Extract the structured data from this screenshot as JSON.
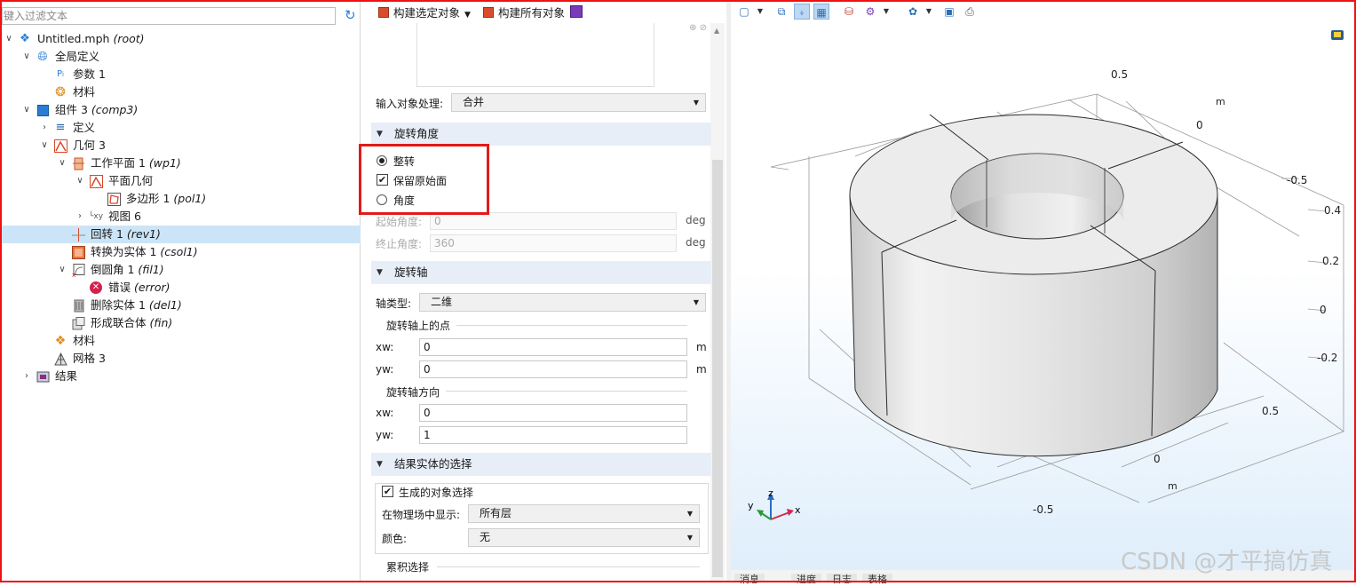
{
  "tree": {
    "filter_placeholder": "键入过滤文本",
    "items": [
      {
        "label": "Untitled.mph",
        "tag": "(root)"
      },
      {
        "label": "全局定义",
        "tag": ""
      },
      {
        "label": "参数 1",
        "tag": ""
      },
      {
        "label": "材料",
        "tag": ""
      },
      {
        "label": "组件 3",
        "tag": "(comp3)"
      },
      {
        "label": "定义",
        "tag": ""
      },
      {
        "label": "几何 3",
        "tag": ""
      },
      {
        "label": "工作平面 1",
        "tag": "(wp1)"
      },
      {
        "label": "平面几何",
        "tag": ""
      },
      {
        "label": "多边形 1",
        "tag": "(pol1)"
      },
      {
        "label": "视图 6",
        "tag": ""
      },
      {
        "label": "回转 1",
        "tag": "(rev1)"
      },
      {
        "label": "转换为实体 1",
        "tag": "(csol1)"
      },
      {
        "label": "倒圆角 1",
        "tag": "(fil1)"
      },
      {
        "label": "错误",
        "tag": "(error)"
      },
      {
        "label": "删除实体 1",
        "tag": "(del1)"
      },
      {
        "label": "形成联合体",
        "tag": "(fin)"
      },
      {
        "label": "材料",
        "tag": ""
      },
      {
        "label": "网格 3",
        "tag": ""
      },
      {
        "label": "结果",
        "tag": ""
      }
    ]
  },
  "settings": {
    "build_selected": "构建选定对象",
    "build_all": "构建所有对象",
    "input_handling_label": "输入对象处理:",
    "input_handling_value": "合并",
    "sec_angle": "旋转角度",
    "opt_full": "整转",
    "opt_keep": "保留原始面",
    "opt_angle": "角度",
    "start_angle_label": "起始角度:",
    "start_angle_value": "0",
    "end_angle_label": "终止角度:",
    "end_angle_value": "360",
    "deg": "deg",
    "sec_axis": "旋转轴",
    "axis_type_label": "轴类型:",
    "axis_type_value": "二维",
    "point_group": "旋转轴上的点",
    "xw_label": "xw:",
    "yw_label": "yw:",
    "point_xw": "0",
    "point_yw": "0",
    "unit_m": "m",
    "dir_group": "旋转轴方向",
    "dir_xw": "0",
    "dir_yw": "1",
    "sec_result": "结果实体的选择",
    "gen_selection": "生成的对象选择",
    "show_in_physics_label": "在物理场中显示:",
    "show_in_physics_value": "所有层",
    "color_label": "颜色:",
    "color_value": "无",
    "cumulative": "累积选择"
  },
  "viewport": {
    "axis_labels": {
      "top_05": "0.5",
      "top_0": "0",
      "top_m": "m",
      "right_m05": "-0.5",
      "right_04": "0.4",
      "right_02": "0.2",
      "right_0": "0",
      "right_m02": "-0.2",
      "bot_05": "0.5",
      "bot_0": "0",
      "bot_m": "m",
      "bot_m05": "-0.5"
    },
    "triad": {
      "x": "x",
      "y": "y",
      "z": "z"
    },
    "tabs": [
      "消息",
      "进度",
      "日志",
      "表格"
    ]
  },
  "watermark": "CSDN @才平搞仿真",
  "colors": {
    "highlight": "#e01b1b",
    "selection": "#cce4f7",
    "section": "#e7eef7"
  }
}
